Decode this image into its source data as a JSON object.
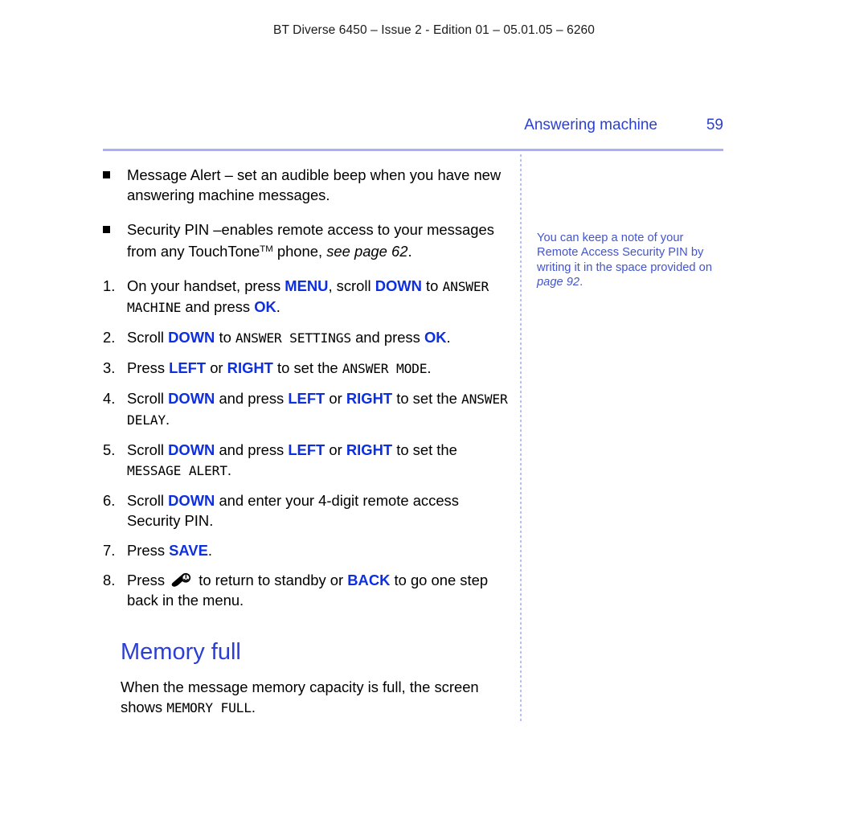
{
  "document": {
    "running_header": "BT Diverse 6450 – Issue 2 - Edition 01 – 05.01.05 – 6260",
    "section_title": "Answering machine",
    "page_number": "59"
  },
  "colors": {
    "heading_blue": "#2b3fd4",
    "key_blue": "#0d2fe0",
    "note_blue": "#4455cc",
    "rule_lavender": "#a9aeff",
    "divider_blue": "#b9c0f5",
    "body_black": "#000000"
  },
  "bullets": [
    {
      "text_before": "Message Alert – set an audible beep when you have new answering machine messages."
    },
    {
      "part1": "Security PIN –enables remote access to your messages from any TouchTone",
      "trademark": "TM",
      "part2": " phone, ",
      "italic_ref": "see page 62",
      "part3": "."
    }
  ],
  "steps": [
    {
      "num": "1.",
      "seg": [
        {
          "t": "On your handset, press ",
          "s": "plain"
        },
        {
          "t": "MENU",
          "s": "key"
        },
        {
          "t": ", scroll ",
          "s": "plain"
        },
        {
          "t": "DOWN",
          "s": "key"
        },
        {
          "t": " to ",
          "s": "plain"
        },
        {
          "t": "ANSWER MACHINE",
          "s": "lcd"
        },
        {
          "t": " and press ",
          "s": "plain"
        },
        {
          "t": "OK",
          "s": "key"
        },
        {
          "t": ".",
          "s": "plain"
        }
      ]
    },
    {
      "num": "2.",
      "seg": [
        {
          "t": "Scroll ",
          "s": "plain"
        },
        {
          "t": "DOWN",
          "s": "key"
        },
        {
          "t": " to ",
          "s": "plain"
        },
        {
          "t": "ANSWER SETTINGS",
          "s": "lcd"
        },
        {
          "t": " and press ",
          "s": "plain"
        },
        {
          "t": "OK",
          "s": "key"
        },
        {
          "t": ".",
          "s": "plain"
        }
      ]
    },
    {
      "num": "3.",
      "seg": [
        {
          "t": "Press ",
          "s": "plain"
        },
        {
          "t": "LEFT",
          "s": "key"
        },
        {
          "t": " or ",
          "s": "plain"
        },
        {
          "t": "RIGHT",
          "s": "key"
        },
        {
          "t": " to set the ",
          "s": "plain"
        },
        {
          "t": "ANSWER MODE",
          "s": "lcd"
        },
        {
          "t": ".",
          "s": "plain"
        }
      ]
    },
    {
      "num": "4.",
      "seg": [
        {
          "t": "Scroll ",
          "s": "plain"
        },
        {
          "t": "DOWN",
          "s": "key"
        },
        {
          "t": " and press ",
          "s": "plain"
        },
        {
          "t": "LEFT",
          "s": "key"
        },
        {
          "t": " or ",
          "s": "plain"
        },
        {
          "t": "RIGHT",
          "s": "key"
        },
        {
          "t": " to set the ",
          "s": "plain"
        },
        {
          "t": "ANSWER DELAY",
          "s": "lcd"
        },
        {
          "t": ".",
          "s": "plain"
        }
      ]
    },
    {
      "num": "5.",
      "seg": [
        {
          "t": "Scroll ",
          "s": "plain"
        },
        {
          "t": "DOWN",
          "s": "key"
        },
        {
          "t": " and press ",
          "s": "plain"
        },
        {
          "t": "LEFT",
          "s": "key"
        },
        {
          "t": " or ",
          "s": "plain"
        },
        {
          "t": "RIGHT",
          "s": "key"
        },
        {
          "t": " to set the ",
          "s": "plain"
        },
        {
          "t": "MESSAGE ALERT",
          "s": "lcd"
        },
        {
          "t": ".",
          "s": "plain"
        }
      ]
    },
    {
      "num": "6.",
      "seg": [
        {
          "t": "Scroll ",
          "s": "plain"
        },
        {
          "t": "DOWN",
          "s": "key"
        },
        {
          "t": " and enter your 4-digit remote access Security PIN.",
          "s": "plain"
        }
      ]
    },
    {
      "num": "7.",
      "seg": [
        {
          "t": "Press ",
          "s": "plain"
        },
        {
          "t": "SAVE",
          "s": "key"
        },
        {
          "t": ".",
          "s": "plain"
        }
      ]
    },
    {
      "num": "8.",
      "seg": [
        {
          "t": "Press ",
          "s": "plain"
        },
        {
          "t": "",
          "s": "handset-icon"
        },
        {
          "t": " to return to standby or ",
          "s": "plain"
        },
        {
          "t": "BACK",
          "s": "key"
        },
        {
          "t": " to go one step back in the menu.",
          "s": "plain"
        }
      ]
    }
  ],
  "sub_section": {
    "heading": "Memory full",
    "paragraph_part1": "When the message memory capacity is full, the screen shows ",
    "paragraph_lcd": "MEMORY FULL",
    "paragraph_part2": "."
  },
  "side_note": {
    "line_text": "You can keep a note of your Remote Access Security PIN by writing it in the space provided on ",
    "italic_ref": "page 92",
    "trailing": "."
  }
}
